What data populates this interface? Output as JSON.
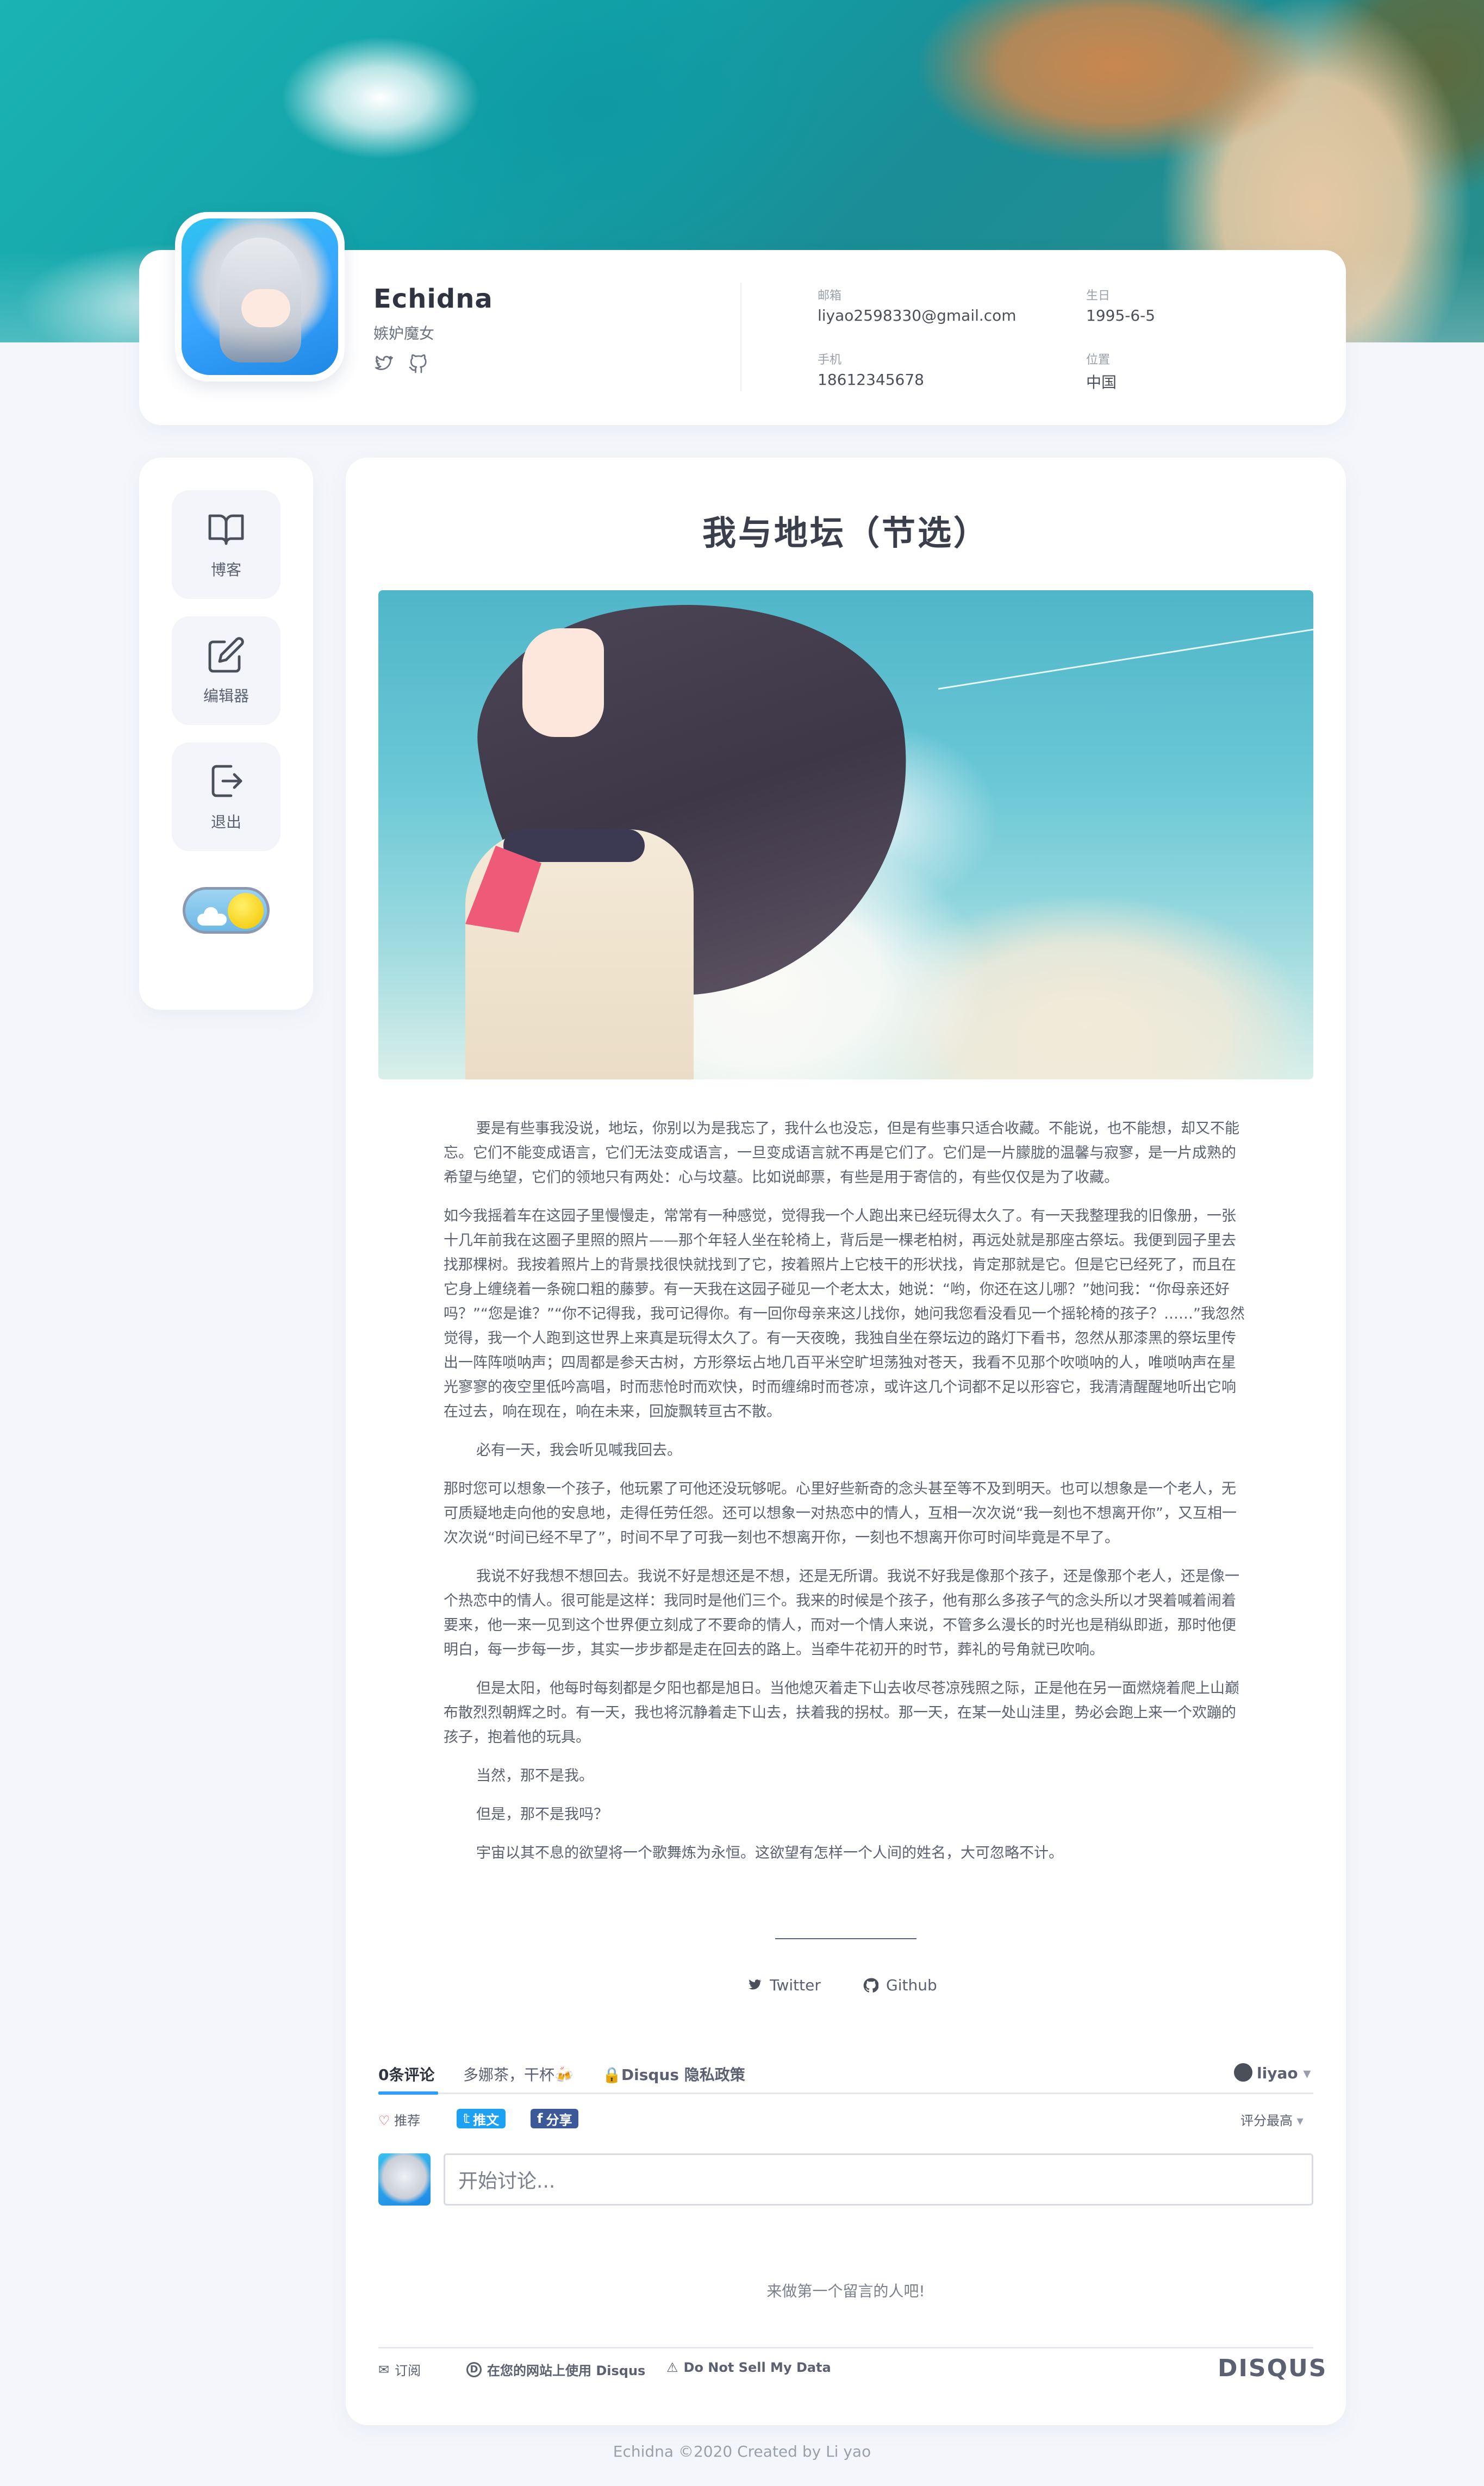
{
  "profile": {
    "name": "Echidna",
    "subtitle": "嫉妒魔女",
    "icons": [
      "twitter-icon",
      "github-icon"
    ],
    "info": {
      "email_label": "邮箱",
      "email": "liyao2598330@gmail.com",
      "birthday_label": "生日",
      "birthday": "1995-6-5",
      "phone_label": "手机",
      "phone": "18612345678",
      "location_label": "位置",
      "location": "中国"
    }
  },
  "sidebar": {
    "items": [
      {
        "label": "博客",
        "icon": "book-icon"
      },
      {
        "label": "编辑器",
        "icon": "edit-icon"
      },
      {
        "label": "退出",
        "icon": "logout-icon"
      }
    ],
    "theme_toggle": "light"
  },
  "article": {
    "title": "我与地坛（节选）",
    "paragraphs": [
      "要是有些事我没说，地坛，你别以为是我忘了，我什么也没忘，但是有些事只适合收藏。不能说，也不能想，却又不能忘。它们不能变成语言，它们无法变成语言，一旦变成语言就不再是它们了。它们是一片朦胧的温馨与寂寥，是一片成熟的希望与绝望，它们的领地只有两处：心与坟墓。比如说邮票，有些是用于寄信的，有些仅仅是为了收藏。",
      "如今我摇着车在这园子里慢慢走，常常有一种感觉，觉得我一个人跑出来已经玩得太久了。有一天我整理我的旧像册，一张十几年前我在这圈子里照的照片——那个年轻人坐在轮椅上，背后是一棵老柏树，再远处就是那座古祭坛。我便到园子里去找那棵树。我按着照片上的背景找很快就找到了它，按着照片上它枝干的形状找，肯定那就是它。但是它已经死了，而且在它身上缠绕着一条碗口粗的藤萝。有一天我在这园子碰见一个老太太，她说：“哟，你还在这儿哪？”她问我：“你母亲还好吗？”“您是谁？”“你不记得我，我可记得你。有一回你母亲来这儿找你，她问我您看没看见一个摇轮椅的孩子？……”我忽然觉得，我一个人跑到这世界上来真是玩得太久了。有一天夜晚，我独自坐在祭坛边的路灯下看书，忽然从那漆黑的祭坛里传出一阵阵唢呐声；四周都是参天古树，方形祭坛占地几百平米空旷坦荡独对苍天，我看不见那个吹唢呐的人，唯唢呐声在星光寥寥的夜空里低吟高唱，时而悲怆时而欢快，时而缠绵时而苍凉，或许这几个词都不足以形容它，我清清醒醒地听出它响在过去，响在现在，响在未来，回旋飘转亘古不散。",
      "必有一天，我会听见喊我回去。",
      "那时您可以想象一个孩子，他玩累了可他还没玩够呢。心里好些新奇的念头甚至等不及到明天。也可以想象是一个老人，无可质疑地走向他的安息地，走得任劳任怨。还可以想象一对热恋中的情人，互相一次次说“我一刻也不想离开你”，又互相一次次说“时间已经不早了”，时间不早了可我一刻也不想离开你，一刻也不想离开你可时间毕竟是不早了。",
      "我说不好我想不想回去。我说不好是想还是不想，还是无所谓。我说不好我是像那个孩子，还是像那个老人，还是像一个热恋中的情人。很可能是这样：我同时是他们三个。我来的时候是个孩子，他有那么多孩子气的念头所以才哭着喊着闹着要来，他一来一见到这个世界便立刻成了不要命的情人，而对一个情人来说，不管多么漫长的时光也是稍纵即逝，那时他便明白，每一步每一步，其实一步步都是走在回去的路上。当牵牛花初开的时节，葬礼的号角就已吹响。",
      "但是太阳，他每时每刻都是夕阳也都是旭日。当他熄灭着走下山去收尽苍凉残照之际，正是他在另一面燃烧着爬上山巅布散烈烈朝辉之时。有一天，我也将沉静着走下山去，扶着我的拐杖。那一天，在某一处山洼里，势必会跑上来一个欢蹦的孩子，抱着他的玩具。",
      "当然，那不是我。",
      "但是，那不是我吗？",
      "宇宙以其不息的欲望将一个歌舞炼为永恒。这欲望有怎样一个人间的姓名，大可忽略不计。"
    ],
    "share": {
      "twitter": "Twitter",
      "github": "Github"
    }
  },
  "disqus": {
    "tabs": {
      "comments": "0条评论",
      "community": "多娜茶，干杯🍻",
      "privacy": "Disqus 隐私政策"
    },
    "user": "liyao",
    "recommend": "推荐",
    "tweet": "推文",
    "share": "分享",
    "sort": "评分最高",
    "placeholder": "开始讨论...",
    "empty": "来做第一个留言的人吧!",
    "footer": {
      "subscribe": "订阅",
      "use": "在您的网站上使用 Disqus",
      "dnsmd": "Do Not Sell My Data",
      "logo": "DISQUS"
    },
    "colors": {
      "twitter": "#1da1f2",
      "facebook": "#3b5998",
      "accent": "#2e9fff"
    }
  },
  "footer": {
    "text": "Echidna ©2020 Created by Li yao"
  }
}
